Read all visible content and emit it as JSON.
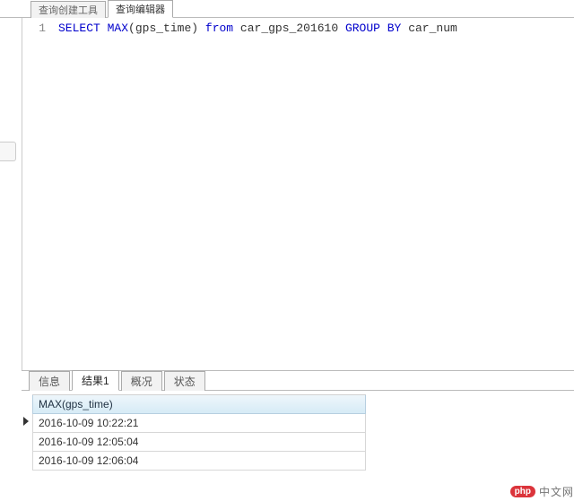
{
  "top_tabs": {
    "builder": "查询创建工具",
    "editor": "查询编辑器"
  },
  "editor": {
    "line_no": "1",
    "sql": {
      "select": "SELECT",
      "max_fn": "MAX",
      "max_arg_open": "(",
      "max_arg": "gps_time",
      "max_arg_close": ")",
      "from": "from",
      "table": "car_gps_201610",
      "group_by": "GROUP BY",
      "group_col": "car_num"
    }
  },
  "result_tabs": {
    "info": "信息",
    "result1": "结果1",
    "profile": "概况",
    "status": "状态"
  },
  "grid": {
    "header": "MAX(gps_time)",
    "rows": [
      "2016-10-09 10:22:21",
      "2016-10-09 12:05:04",
      "2016-10-09 12:06:04"
    ]
  },
  "watermark": {
    "badge": "php",
    "text": "中文网"
  }
}
